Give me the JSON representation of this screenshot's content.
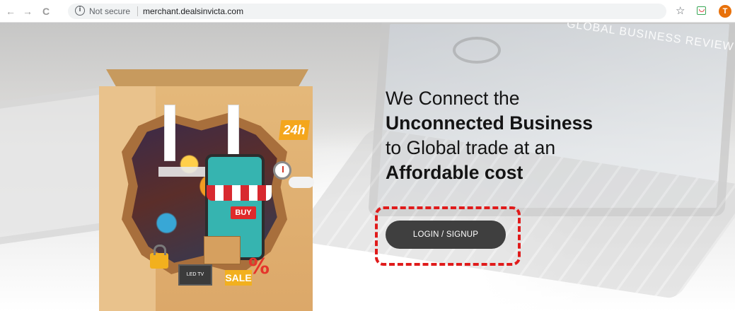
{
  "browser": {
    "back_icon": "←",
    "forward_icon": "→",
    "reload_icon": "C",
    "security_icon": "i",
    "security_label": "Not secure",
    "url": "merchant.dealsinvicta.com",
    "bookmark_icon": "☆",
    "profile_initial": "T"
  },
  "hero": {
    "background_screen_text": "GLOBAL BUSINESS REVIEW",
    "illustration": {
      "badge_24": "24h",
      "buy_label": "BUY",
      "sale_label": "SALE",
      "percent_label": "%",
      "tv_label": "LED TV"
    },
    "headline": {
      "line1": "We Connect the",
      "line2": "Unconnected Business",
      "line3": "to Global trade at an",
      "line4": "Affordable cost"
    },
    "login_button_label": "LOGIN / SIGNUP"
  },
  "colors": {
    "button_bg": "#3f3f3f",
    "highlight_border": "#e01b1b",
    "avatar_bg": "#e8710a"
  }
}
